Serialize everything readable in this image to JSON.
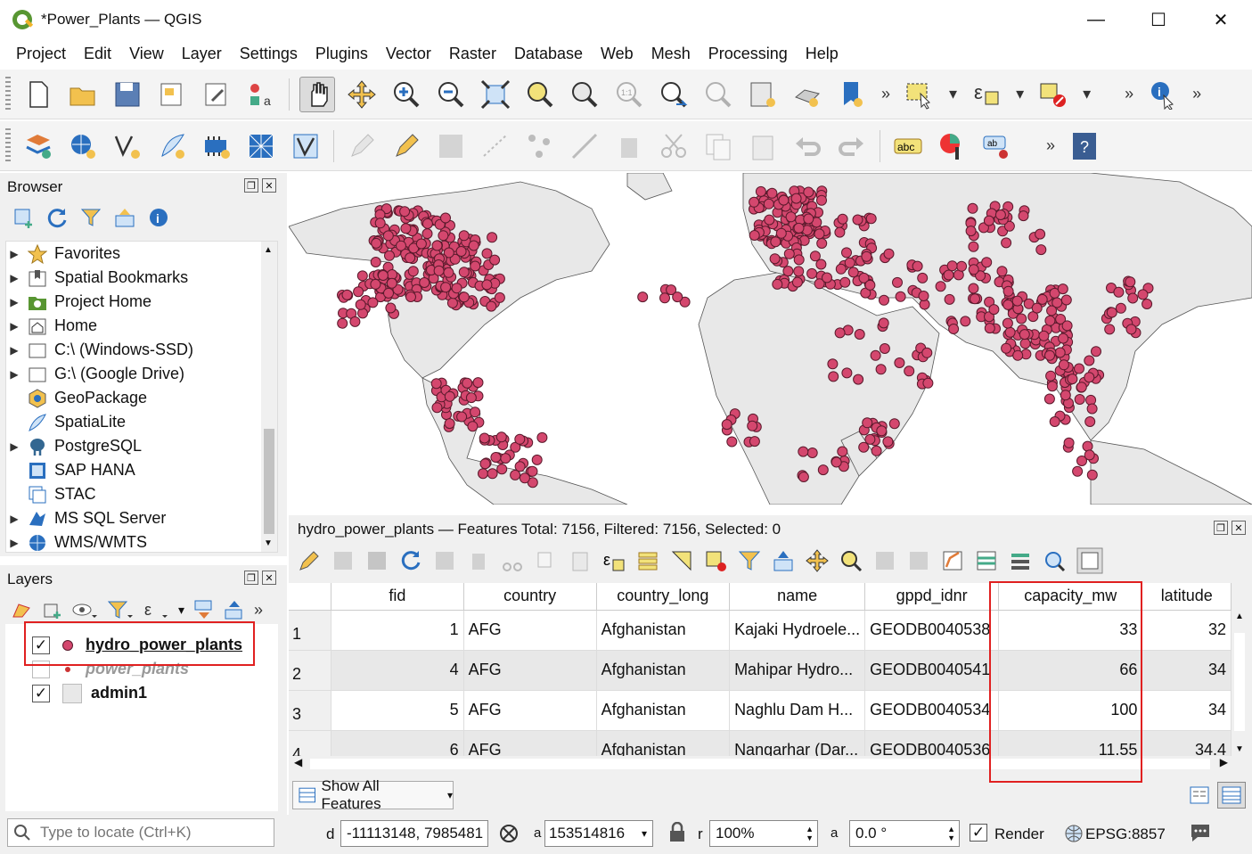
{
  "window": {
    "title": "*Power_Plants — QGIS",
    "minimize": "—",
    "maximize": "☐",
    "close": "✕"
  },
  "menu": [
    "Project",
    "Edit",
    "View",
    "Layer",
    "Settings",
    "Plugins",
    "Vector",
    "Raster",
    "Database",
    "Web",
    "Mesh",
    "Processing",
    "Help"
  ],
  "browser": {
    "title": "Browser",
    "items": [
      {
        "label": "Favorites",
        "icon": "star-icon",
        "arrow": true
      },
      {
        "label": "Spatial Bookmarks",
        "icon": "bookmark-icon",
        "arrow": true
      },
      {
        "label": "Project Home",
        "icon": "project-folder-icon",
        "arrow": true
      },
      {
        "label": "Home",
        "icon": "home-icon",
        "arrow": true
      },
      {
        "label": "C:\\ (Windows-SSD)",
        "icon": "drive-icon",
        "arrow": true
      },
      {
        "label": "G:\\ (Google Drive)",
        "icon": "drive-icon",
        "arrow": true
      },
      {
        "label": "GeoPackage",
        "icon": "geopackage-icon",
        "arrow": false
      },
      {
        "label": "SpatiaLite",
        "icon": "spatialite-icon",
        "arrow": false
      },
      {
        "label": "PostgreSQL",
        "icon": "postgresql-icon",
        "arrow": true
      },
      {
        "label": "SAP HANA",
        "icon": "sap-hana-icon",
        "arrow": false
      },
      {
        "label": "STAC",
        "icon": "stac-icon",
        "arrow": false
      },
      {
        "label": "MS SQL Server",
        "icon": "mssql-icon",
        "arrow": true
      },
      {
        "label": "WMS/WMTS",
        "icon": "globe-icon",
        "arrow": true
      }
    ]
  },
  "layers": {
    "title": "Layers",
    "items": [
      {
        "label": "hydro_power_plants",
        "checked": true
      },
      {
        "label": "power_plants",
        "checked": false
      },
      {
        "label": "admin1",
        "checked": true
      }
    ]
  },
  "attribute_table": {
    "title": "hydro_power_plants — Features Total: 7156, Filtered: 7156, Selected: 0",
    "columns": [
      "fid",
      "country",
      "country_long",
      "name",
      "gppd_idnr",
      "capacity_mw",
      "latitude"
    ],
    "rows": [
      {
        "rn": "1",
        "fid": "1",
        "country": "AFG",
        "country_long": "Afghanistan",
        "name": "Kajaki Hydroele...",
        "gppd_idnr": "GEODB0040538",
        "capacity_mw": "33",
        "latitude": "32"
      },
      {
        "rn": "2",
        "fid": "4",
        "country": "AFG",
        "country_long": "Afghanistan",
        "name": "Mahipar Hydro...",
        "gppd_idnr": "GEODB0040541",
        "capacity_mw": "66",
        "latitude": "34"
      },
      {
        "rn": "3",
        "fid": "5",
        "country": "AFG",
        "country_long": "Afghanistan",
        "name": "Naghlu Dam H...",
        "gppd_idnr": "GEODB0040534",
        "capacity_mw": "100",
        "latitude": "34"
      },
      {
        "rn": "4",
        "fid": "6",
        "country": "AFG",
        "country_long": "Afghanistan",
        "name": "Nangarhar (Dar...",
        "gppd_idnr": "GEODB0040536",
        "capacity_mw": "11.55",
        "latitude": "34.4"
      }
    ],
    "show_all": "Show All Features"
  },
  "status": {
    "locate_placeholder": "Type to locate (Ctrl+K)",
    "coord_label": "d",
    "coordinate": "-11113148, 7985481",
    "scale_label": "a",
    "scale": "153514816",
    "mag_label": "r",
    "magnifier": "100%",
    "rot_label": "a",
    "rotation": "0.0 °",
    "render": "Render",
    "crs": "EPSG:8857"
  },
  "colors": {
    "point": "#d4476e",
    "point_stroke": "#5a1a2c",
    "land": "#e8e8e8",
    "highlight": "#e02020"
  }
}
